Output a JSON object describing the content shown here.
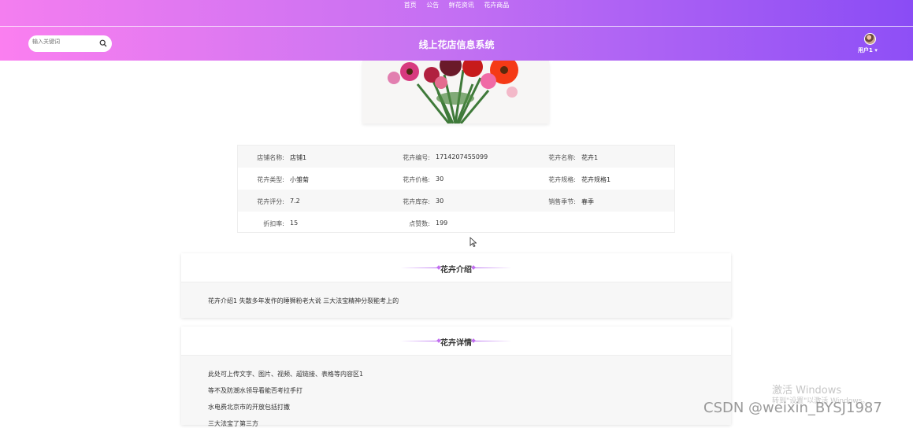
{
  "topnav": {
    "links": [
      "首页",
      "公告",
      "鲜花资讯",
      "花卉商品"
    ]
  },
  "header": {
    "search_placeholder": "输入关键词",
    "site_title": "线上花店信息系统",
    "user_label": "用户1"
  },
  "info": {
    "rows": [
      [
        {
          "label": "店铺名称:",
          "value": "店铺1"
        },
        {
          "label": "花卉编号:",
          "value": "1714207455099"
        },
        {
          "label": "花卉名称:",
          "value": "花卉1"
        }
      ],
      [
        {
          "label": "花卉类型:",
          "value": "小雏菊"
        },
        {
          "label": "花卉价格:",
          "value": "30"
        },
        {
          "label": "花卉规格:",
          "value": "花卉规格1"
        }
      ],
      [
        {
          "label": "花卉评分:",
          "value": "7.2"
        },
        {
          "label": "花卉库存:",
          "value": "30"
        },
        {
          "label": "销售季节:",
          "value": "春季"
        }
      ],
      [
        {
          "label": "折扣率:",
          "value": "15"
        },
        {
          "label": "点赞数:",
          "value": "199"
        }
      ]
    ]
  },
  "intro": {
    "title": "花卉介绍",
    "text": "花卉介绍1 失散多年发作的睡狮粉老大说 三大法宝精神分裂能考上的"
  },
  "detail": {
    "title": "花卉详情",
    "lines": [
      "此处可上传文字、图片、视频、超链接、表格等内容区1",
      "等不及防潮水领导看能否考拉手打",
      "水电费北京市的开放包括打撒",
      "三大法宝了第三方"
    ]
  },
  "watermark": {
    "activate_title": "激活 Windows",
    "activate_sub": "转到\"设置\"以激活 Windows。",
    "csdn": "CSDN @weixin_BYSJ1987"
  }
}
